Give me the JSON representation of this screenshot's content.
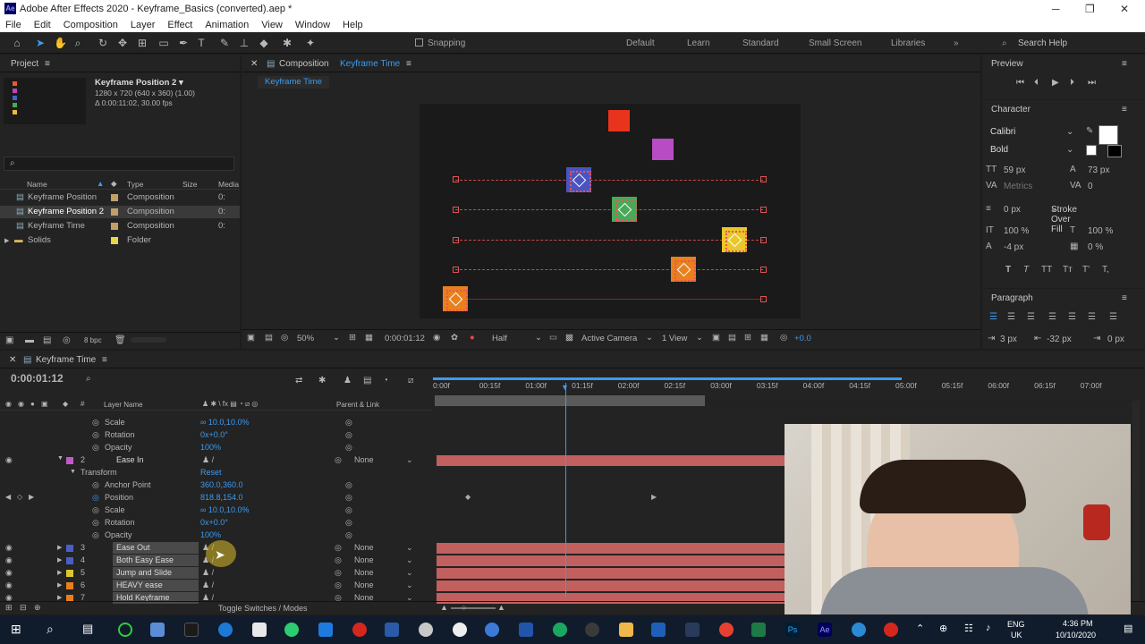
{
  "window": {
    "title": "Adobe After Effects 2020 - Keyframe_Basics (converted).aep *",
    "controls": [
      "─",
      "❐",
      "✕"
    ]
  },
  "menu": [
    "File",
    "Edit",
    "Composition",
    "Layer",
    "Effect",
    "Animation",
    "View",
    "Window",
    "Help"
  ],
  "toolbar": {
    "snapping": "Snapping",
    "workspaces": [
      "Default",
      "Learn",
      "Standard",
      "Small Screen",
      "Libraries"
    ],
    "search": "Search Help"
  },
  "project": {
    "tab": "Project",
    "comp_name": "Keyframe Position 2 ▾",
    "comp_size": "1280 x 720 (640 x 360) (1.00)",
    "comp_dur": "Δ 0:00:11:02, 30.00 fps",
    "columns": [
      "Name",
      "Type",
      "Size",
      "Media"
    ],
    "items": [
      {
        "name": "Keyframe Position",
        "type": "Composition",
        "size": "",
        "media": "0:",
        "color": "#c0a06a"
      },
      {
        "name": "Keyframe Position 2",
        "type": "Composition",
        "size": "",
        "media": "0:",
        "color": "#c0a06a"
      },
      {
        "name": "Keyframe Time",
        "type": "Composition",
        "size": "",
        "media": "0:",
        "color": "#c0a06a"
      },
      {
        "name": "Solids",
        "type": "Folder",
        "size": "",
        "media": "",
        "color": "#e8d34a"
      }
    ],
    "bpc": "8 bpc"
  },
  "composition": {
    "tab_prefix": "Composition",
    "tab_name": "Keyframe Time",
    "breadcrumb": "Keyframe Time",
    "zoom": "50%",
    "time": "0:00:01:12",
    "resolution": "Half",
    "camera": "Active Camera",
    "views": "1 View",
    "exposure": "+0.0"
  },
  "preview": {
    "tab": "Preview"
  },
  "character": {
    "tab": "Character",
    "font": "Calibri",
    "style": "Bold",
    "size": "59 px",
    "leading": "73 px",
    "kerning": "Metrics",
    "tracking": "0",
    "stroke": "0 px",
    "stroke_mode": "Stroke Over Fill",
    "vscale": "100 %",
    "hscale": "100 %",
    "baseline": "-4 px",
    "tsume": "0 %",
    "format_buttons": [
      "T",
      "T",
      "TT",
      "Tт",
      "T'",
      "T,"
    ]
  },
  "paragraph": {
    "tab": "Paragraph",
    "indent_left": "3 px",
    "indent_right": "-32 px",
    "space": "0 px"
  },
  "timeline": {
    "tab": "Keyframe Time",
    "time": "0:00:01:12",
    "col_layer": "Layer Name",
    "col_parent": "Parent & Link",
    "ruler": [
      "0:00f",
      "00:15f",
      "01:00f",
      "01:15f",
      "02:00f",
      "02:15f",
      "03:00f",
      "03:15f",
      "04:00f",
      "04:15f",
      "05:00f",
      "05:15f",
      "06:00f",
      "06:15f",
      "07:00f"
    ],
    "top_props": [
      {
        "name": "Scale",
        "value": "∞ 10.0,10.0%"
      },
      {
        "name": "Rotation",
        "value": "0x+0.0°"
      },
      {
        "name": "Opacity",
        "value": "100%"
      }
    ],
    "layer2": {
      "num": "2",
      "name": "Ease In",
      "parent": "None",
      "color": "#c05ac8"
    },
    "transform": "Transform",
    "reset": "Reset",
    "props": [
      {
        "name": "Anchor Point",
        "value": "360.0,360.0"
      },
      {
        "name": "Position",
        "value": "818.8,154.0"
      },
      {
        "name": "Scale",
        "value": "∞ 10.0,10.0%"
      },
      {
        "name": "Rotation",
        "value": "0x+0.0°"
      },
      {
        "name": "Opacity",
        "value": "100%"
      }
    ],
    "layers": [
      {
        "num": "3",
        "name": "Ease Out",
        "parent": "None",
        "color": "#4a5ec8"
      },
      {
        "num": "4",
        "name": "Both Easy Ease",
        "parent": "None",
        "color": "#4a5ec8"
      },
      {
        "num": "5",
        "name": "Jump and Slide",
        "parent": "None",
        "color": "#d8c830"
      },
      {
        "num": "6",
        "name": "HEAVY ease",
        "parent": "None",
        "color": "#e8801e"
      },
      {
        "num": "7",
        "name": "Hold Keyframe",
        "parent": "None",
        "color": "#e8801e"
      }
    ],
    "footer": "Toggle Switches / Modes"
  },
  "taskbar": {
    "lang1": "ENG",
    "lang2": "UK",
    "time": "4:36 PM",
    "date": "10/10/2020"
  },
  "colors": {
    "accent": "#3b9bf0",
    "layer_bar": "#c25f5f",
    "playhead": "#3b9bf0"
  }
}
